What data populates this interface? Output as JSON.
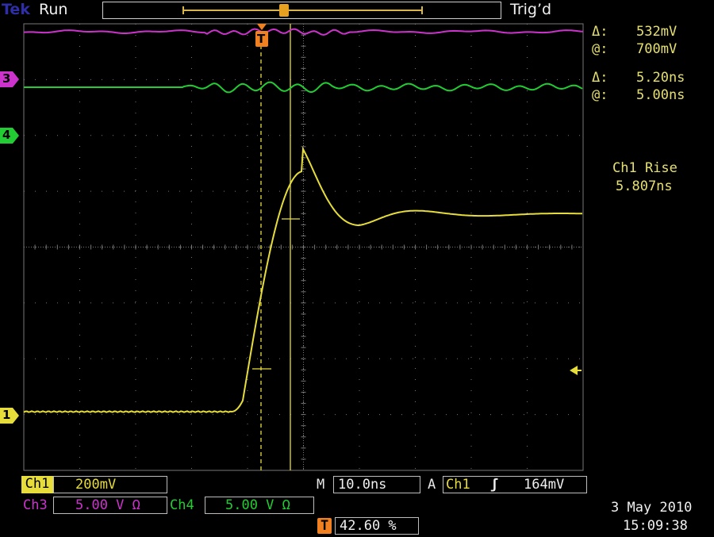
{
  "top_bar": {
    "brand": "Tek",
    "state": "Run",
    "trigger_state": "Trig’d"
  },
  "readouts": {
    "delta_v_symbol": "Δ:",
    "delta_v_value": "532mV",
    "at_v_symbol": "@:",
    "at_v_value": "700mV",
    "delta_t_symbol": "Δ:",
    "delta_t_value": "5.20ns",
    "at_t_symbol": "@:",
    "at_t_value": "5.00ns",
    "measure_label": "Ch1 Rise",
    "measure_value": "5.807ns"
  },
  "channel_markers": {
    "ch1": "1",
    "ch3": "3",
    "ch4": "4",
    "trigger": "T"
  },
  "bottom": {
    "ch1_label": "Ch1",
    "ch1_scale": "200mV",
    "ch3_label": "Ch3",
    "ch3_scale": "5.00 V Ω",
    "ch4_label": "Ch4",
    "ch4_scale": "5.00 V Ω",
    "timebase_label": "M",
    "timebase_value": "10.0ns",
    "trigger_mode": "A",
    "trigger_source": "Ch1",
    "trigger_slope": "ʃ",
    "trigger_level": "164mV",
    "trigger_pos_value": "42.60 %",
    "date": "3 May 2010",
    "time": "15:09:38"
  },
  "colors": {
    "ch1": "#e6dc3a",
    "ch3": "#cc33cc",
    "ch4": "#22cc33",
    "trigger": "#f08020",
    "grid": "#777777"
  }
}
